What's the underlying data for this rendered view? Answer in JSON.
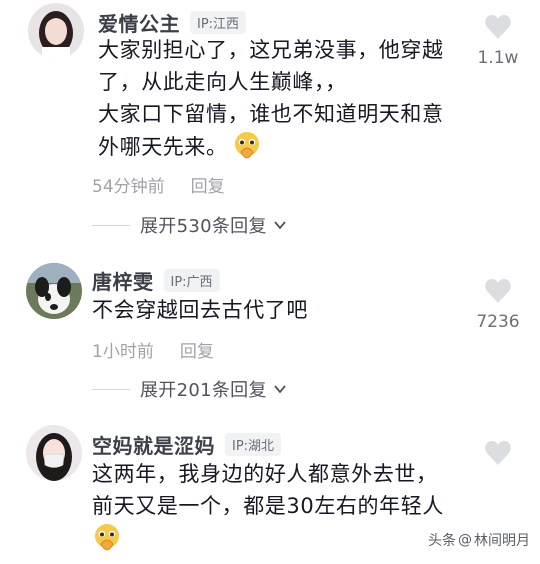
{
  "comments": [
    {
      "username": "爱情公主",
      "ip": "IP:江西",
      "lines": [
        "大家别担心了，这兄弟没事，他穿越",
        "了，从此走向人生巅峰，，",
        "大家口下留情，谁也不知道明天和意",
        "外哪天先来。"
      ],
      "has_emoji": true,
      "time": "54分钟前",
      "reply_label": "回复",
      "expand_label": "展开530条回复",
      "likes": "1.1w"
    },
    {
      "username": "唐梓雯",
      "ip": "IP:广西",
      "lines": [
        "不会穿越回去古代了吧"
      ],
      "has_emoji": false,
      "time": "1小时前",
      "reply_label": "回复",
      "expand_label": "展开201条回复",
      "likes": "7236"
    },
    {
      "username": "空妈就是涩妈",
      "ip": "IP:湖北",
      "lines": [
        "这两年，我身边的好人都意外去世，",
        "前天又是一个，都是30左右的年轻人"
      ],
      "has_emoji": true,
      "likes": ""
    }
  ],
  "watermark": {
    "prefix": "头条",
    "at": "@",
    "author": "林间明月"
  },
  "colors": {
    "username": "#3c3f4a",
    "meta": "#a0a2a8",
    "heart": "#dcdde1"
  },
  "icons": [
    "avatar-image",
    "heart-icon",
    "chevron-down-icon",
    "praying-hands-emoji"
  ]
}
